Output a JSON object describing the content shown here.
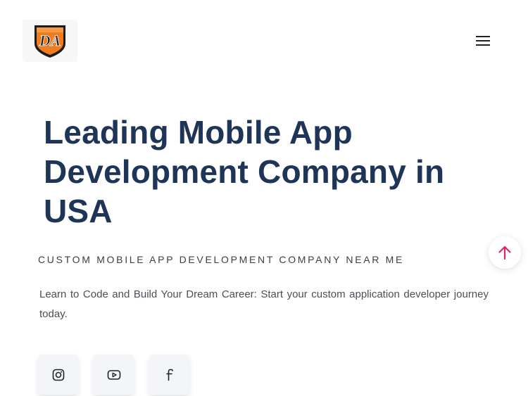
{
  "header": {
    "logo_text": "DA",
    "menu_icon": "hamburger-menu-icon"
  },
  "hero": {
    "title": "Leading Mobile App Development Company in USA",
    "subtitle": "CUSTOM MOBILE APP DEVELOPMENT COMPANY NEAR ME",
    "description": "Learn to Code and Build Your Dream Career: Start your custom application developer journey today."
  },
  "social": [
    {
      "icon": "instagram-icon"
    },
    {
      "icon": "youtube-icon"
    },
    {
      "icon": "facebook-icon"
    }
  ],
  "scroll_top": {
    "icon": "arrow-up-icon"
  },
  "colors": {
    "title": "#1f3557",
    "logo_orange": "#f07c1f",
    "logo_dark": "#1c1c1c",
    "scroll_arrow": "#e0245e"
  }
}
